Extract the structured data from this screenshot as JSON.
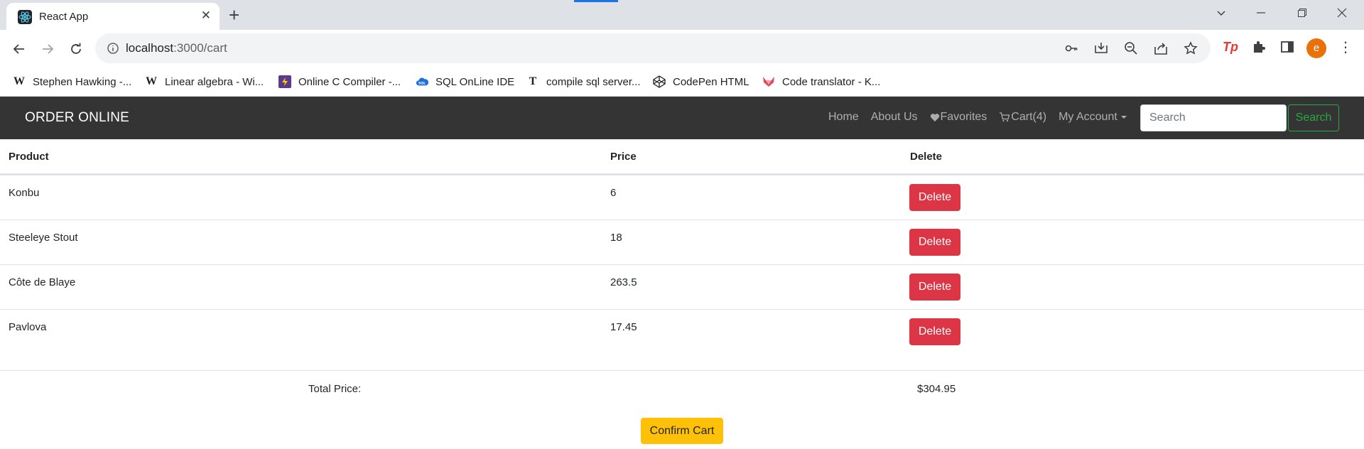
{
  "browser": {
    "tab_title": "React App",
    "url_host": "localhost",
    "url_path": ":3000/cart",
    "avatar_letter": "e",
    "bookmarks": [
      {
        "icon": "wikipedia-icon",
        "label": "Stephen Hawking -..."
      },
      {
        "icon": "wikipedia-icon",
        "label": "Linear algebra - Wi..."
      },
      {
        "icon": "onlinegdb-icon",
        "label": "Online C Compiler -..."
      },
      {
        "icon": "sql-cloud-icon",
        "label": "SQL OnLine IDE"
      },
      {
        "icon": "t-letter-icon",
        "label": "compile sql server..."
      },
      {
        "icon": "codepen-icon",
        "label": "CodePen HTML"
      },
      {
        "icon": "fox-icon",
        "label": "Code translator - K..."
      }
    ]
  },
  "navbar": {
    "brand": "ORDER ONLINE",
    "links": {
      "home": "Home",
      "about": "About Us",
      "favorites": "Favorites",
      "cart": "Cart(4)",
      "account": "My Account"
    },
    "search_placeholder": "Search",
    "search_button": "Search"
  },
  "cart": {
    "headers": {
      "product": "Product",
      "price": "Price",
      "delete": "Delete"
    },
    "items": [
      {
        "product": "Konbu",
        "price": "6",
        "delete_label": "Delete"
      },
      {
        "product": "Steeleye Stout",
        "price": "18",
        "delete_label": "Delete"
      },
      {
        "product": "Côte de Blaye",
        "price": "263.5",
        "delete_label": "Delete"
      },
      {
        "product": "Pavlova",
        "price": "17.45",
        "delete_label": "Delete"
      }
    ],
    "total_label": "Total Price:",
    "total_value": "$304.95",
    "confirm_label": "Confirm Cart"
  },
  "colors": {
    "navbar_bg": "#343434",
    "delete": "#dc3545",
    "confirm": "#ffc107",
    "search_outline": "#28a745"
  }
}
